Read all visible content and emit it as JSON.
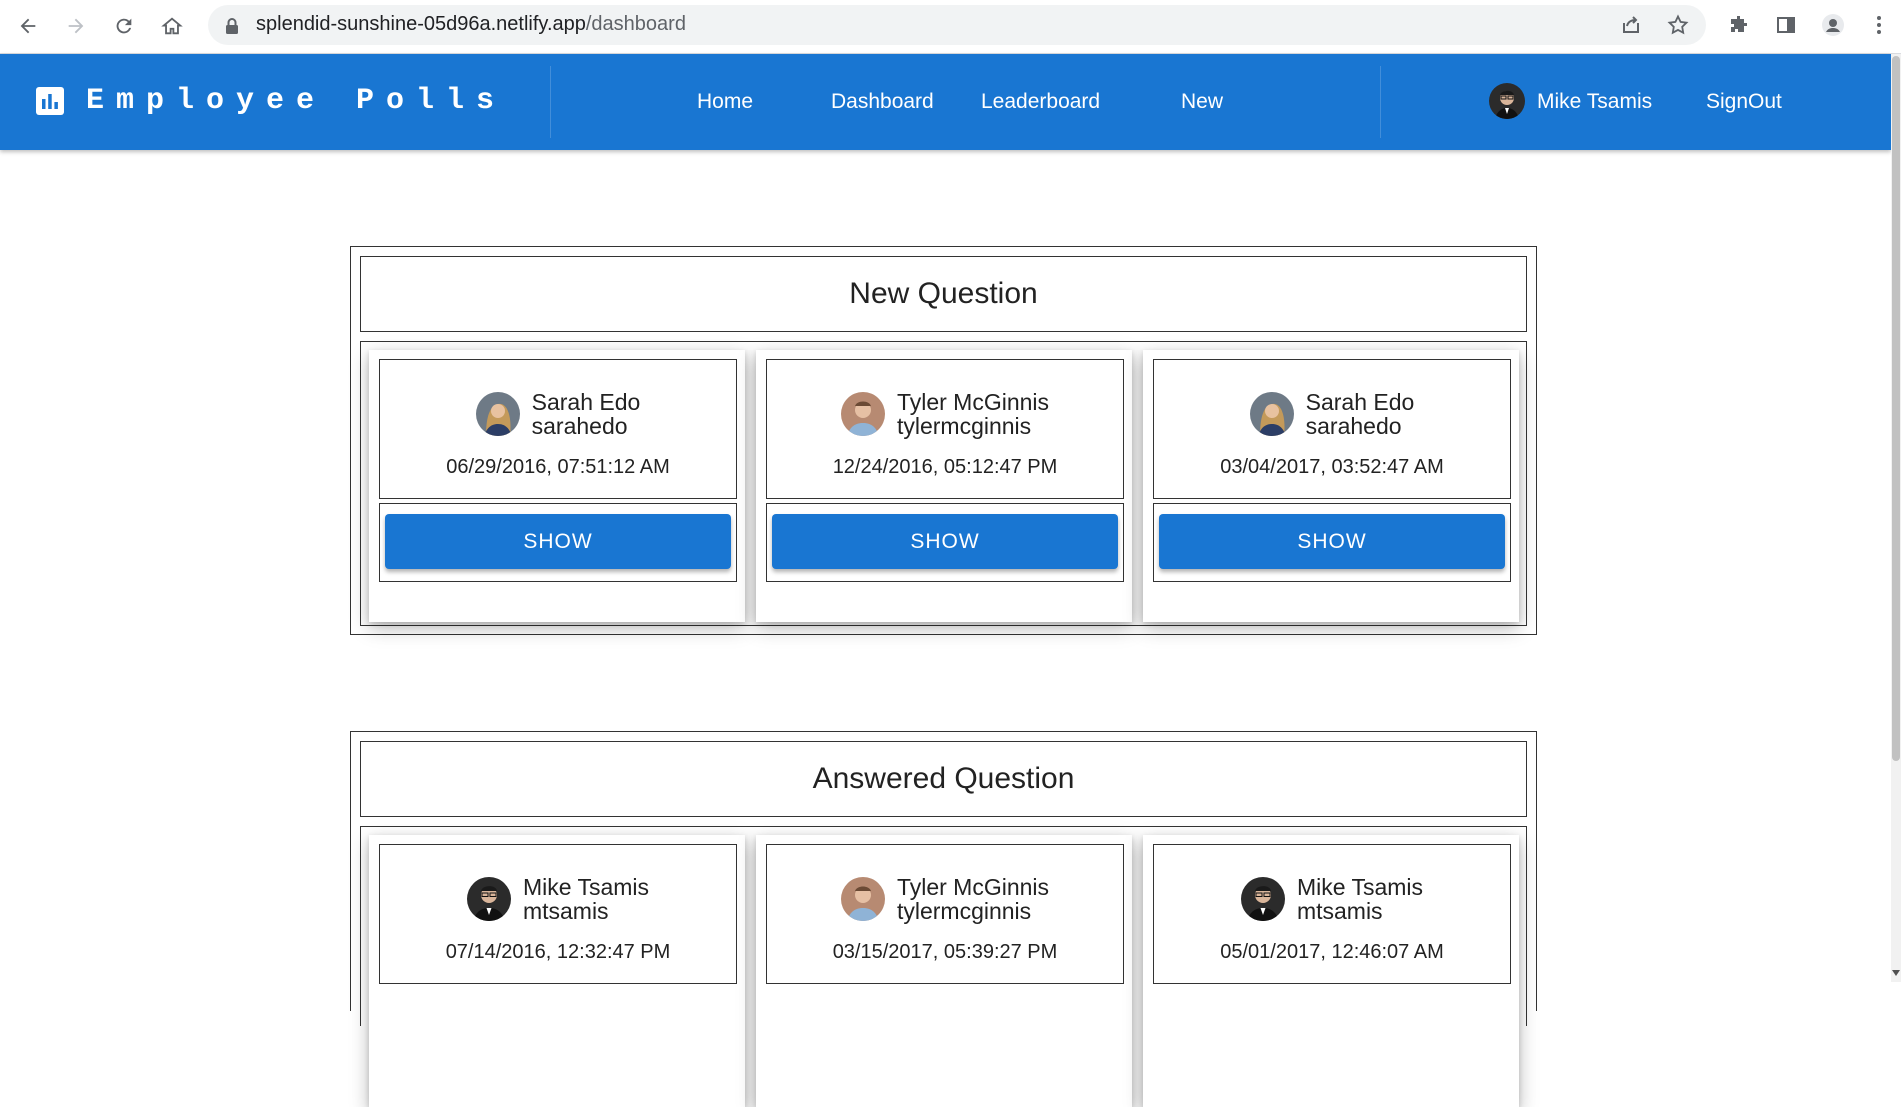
{
  "browser": {
    "url_host": "splendid-sunshine-05d96a.netlify.app",
    "url_path": "/dashboard",
    "icons": [
      "back-arrow-icon",
      "forward-arrow-icon",
      "reload-icon",
      "home-icon",
      "lock-icon",
      "share-icon",
      "star-icon",
      "extensions-icon",
      "side-panel-icon",
      "profile-icon",
      "menu-dots-icon"
    ]
  },
  "appbar": {
    "brand_title": "Employee Polls",
    "brand_icon": "bar-chart-icon",
    "nav": {
      "home": "Home",
      "dashboard": "Dashboard",
      "leaderboard": "Leaderboard",
      "new": "New"
    },
    "user_name": "Mike Tsamis",
    "signout": "SignOut"
  },
  "colors": {
    "primary": "#1976d2",
    "text": "#222222"
  },
  "sections": {
    "new": {
      "title": "New Question",
      "cards": [
        {
          "name": "Sarah Edo",
          "handle": "sarahedo",
          "timestamp": "06/29/2016, 07:51:12 AM",
          "button": "SHOW"
        },
        {
          "name": "Tyler McGinnis",
          "handle": "tylermcginnis",
          "timestamp": "12/24/2016, 05:12:47 PM",
          "button": "SHOW"
        },
        {
          "name": "Sarah Edo",
          "handle": "sarahedo",
          "timestamp": "03/04/2017, 03:52:47 AM",
          "button": "SHOW"
        }
      ]
    },
    "answered": {
      "title": "Answered Question",
      "cards": [
        {
          "name": "Mike Tsamis",
          "handle": "mtsamis",
          "timestamp": "07/14/2016, 12:32:47 PM"
        },
        {
          "name": "Tyler McGinnis",
          "handle": "tylermcginnis",
          "timestamp": "03/15/2017, 05:39:27 PM"
        },
        {
          "name": "Mike Tsamis",
          "handle": "mtsamis",
          "timestamp": "05/01/2017, 12:46:07 AM"
        }
      ]
    }
  }
}
